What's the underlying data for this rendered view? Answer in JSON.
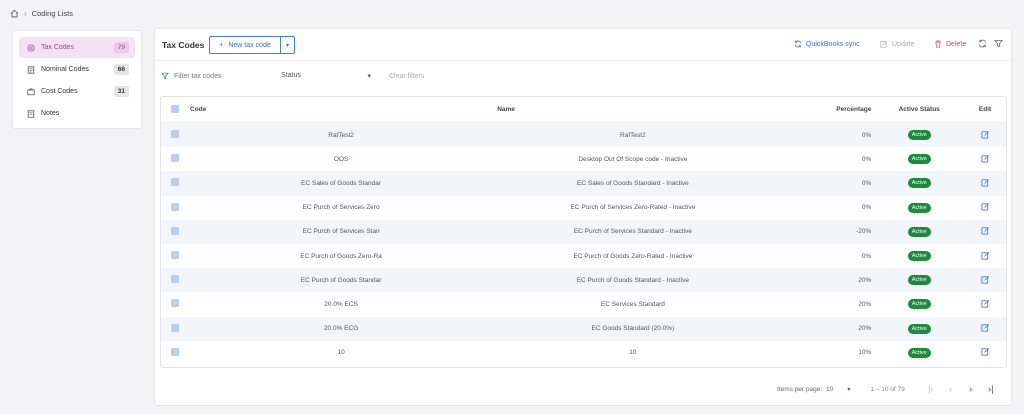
{
  "breadcrumb": {
    "page": "Coding Lists"
  },
  "sidebar": {
    "items": [
      {
        "label": "Tax Codes",
        "count": "79",
        "icon": "tax-icon"
      },
      {
        "label": "Nominal Codes",
        "count": "66",
        "icon": "ledger-icon"
      },
      {
        "label": "Cost Codes",
        "count": "31",
        "icon": "cost-icon"
      },
      {
        "label": "Notes",
        "count": "",
        "icon": "notes-icon"
      }
    ]
  },
  "toolbar": {
    "title": "Tax Codes",
    "new_label": "New tax code",
    "qb_label": "QuickBooks sync",
    "update_label": "Update",
    "delete_label": "Delete"
  },
  "filters": {
    "search_placeholder": "Filter tax codes",
    "status_label": "Status",
    "clear_label": "Clear filters"
  },
  "table": {
    "headers": {
      "code": "Code",
      "name": "Name",
      "percentage": "Percentage",
      "status": "Active Status",
      "edit": "Edit"
    },
    "rows": [
      {
        "code": "RafTest2",
        "name": "RafTest2",
        "percentage": "0%",
        "status": "Active"
      },
      {
        "code": "OOS",
        "name": "Desktop Out Of Scope code - Inactive",
        "percentage": "0%",
        "status": "Active"
      },
      {
        "code": "EC Sales of Goods Standar",
        "name": "EC Sales of Goods Standard - Inactive",
        "percentage": "0%",
        "status": "Active"
      },
      {
        "code": "EC Purch of Services Zero",
        "name": "EC Purch of Services Zero-Rated - Inactive",
        "percentage": "0%",
        "status": "Active"
      },
      {
        "code": "EC Purch of Services Stan",
        "name": "EC Purch of Services Standard - Inactive",
        "percentage": "-20%",
        "status": "Active"
      },
      {
        "code": "EC Purch of Goods Zero-Ra",
        "name": "EC Purch of Goods Zero-Rated - Inactive",
        "percentage": "0%",
        "status": "Active"
      },
      {
        "code": "EC Purch of Goods Standar",
        "name": "EC Purch of Goods Standard - Inactive",
        "percentage": "20%",
        "status": "Active"
      },
      {
        "code": "20.0% ECS",
        "name": "EC Services Standard",
        "percentage": "20%",
        "status": "Active"
      },
      {
        "code": "20.0% ECG",
        "name": "EC Goods Standard (20.0%)",
        "percentage": "20%",
        "status": "Active"
      },
      {
        "code": "10",
        "name": "10",
        "percentage": "10%",
        "status": "Active"
      }
    ]
  },
  "pager": {
    "items_label": "Items per page:",
    "items_value": "10",
    "range": "1 – 10 of 79"
  },
  "colors": {
    "accent": "#3a6fc4",
    "active_nav": "#9c3d95",
    "badge": "#1d8a3e",
    "delete": "#c0487d"
  }
}
